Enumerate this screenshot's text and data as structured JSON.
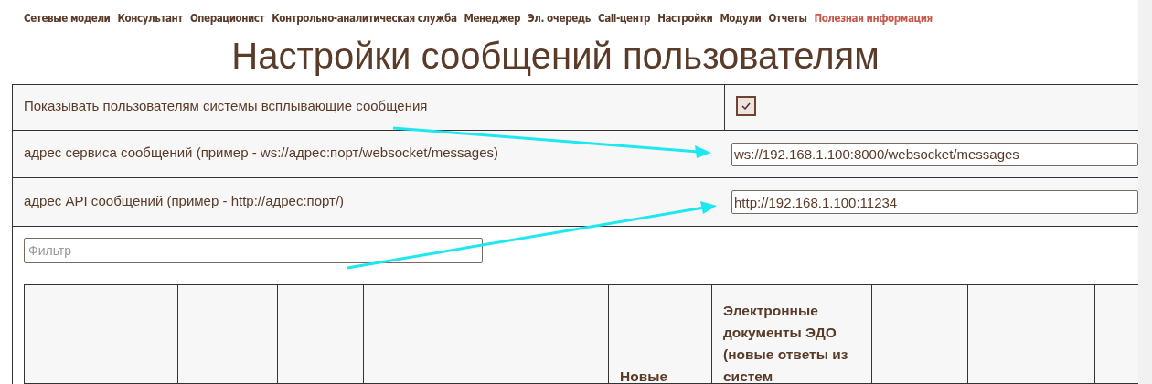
{
  "nav": [
    {
      "label": "Сетевые модели",
      "highlighted": false
    },
    {
      "label": "Консультант",
      "highlighted": false
    },
    {
      "label": "Операционист",
      "highlighted": false
    },
    {
      "label": "Контрольно-аналитическая служба",
      "highlighted": false
    },
    {
      "label": "Менеджер",
      "highlighted": false
    },
    {
      "label": "Эл. очередь",
      "highlighted": false
    },
    {
      "label": "Call-центр",
      "highlighted": false
    },
    {
      "label": "Настройки",
      "highlighted": false
    },
    {
      "label": "Модули",
      "highlighted": false
    },
    {
      "label": "Отчеты",
      "highlighted": false
    },
    {
      "label": "Полезная информация",
      "highlighted": true
    }
  ],
  "title": "Настройки сообщений пользователям",
  "settings": [
    {
      "kind": "checkbox",
      "label": "Показывать пользователям системы всплывающие сообщения",
      "checked": true
    },
    {
      "kind": "text",
      "label": "адрес сервиса сообщений (пример - ws://адрес:порт/websocket/messages)",
      "value": "ws://192.168.1.100:8000/websocket/messages"
    },
    {
      "kind": "text",
      "label": "адрес API сообщений (пример - http://адрес:порт/)",
      "value": "http://192.168.1.100:11234"
    }
  ],
  "filter": {
    "placeholder": "Фильтр"
  },
  "table": {
    "columns": [
      {},
      {},
      {},
      {},
      {},
      {
        "label": "Новые"
      },
      {
        "label": "Электронные документы ЭДО (новые ответы из систем"
      },
      {},
      {},
      {}
    ]
  }
}
